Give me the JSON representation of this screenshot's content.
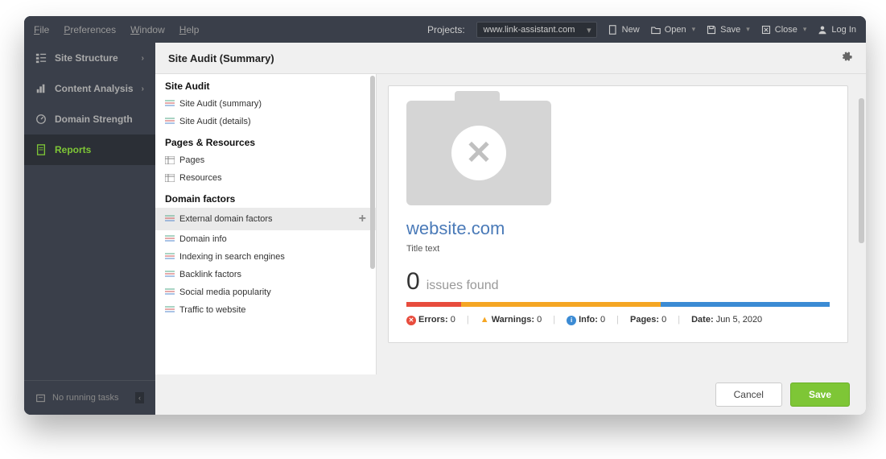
{
  "menubar": {
    "file": "File",
    "preferences": "Preferences",
    "window": "Window",
    "help": "Help",
    "projects_label": "Projects:",
    "project_value": "www.link-assistant.com",
    "new": "New",
    "open": "Open",
    "save": "Save",
    "close": "Close",
    "login": "Log In"
  },
  "sidebar": {
    "items": [
      {
        "label": "Site Structure"
      },
      {
        "label": "Content Analysis"
      },
      {
        "label": "Domain Strength"
      },
      {
        "label": "Reports"
      }
    ],
    "footer": "No running tasks"
  },
  "header": {
    "title": "Site Audit (Summary)"
  },
  "panel": {
    "g1_title": "Site Audit",
    "g1_items": [
      "Site Audit (summary)",
      "Site Audit (details)"
    ],
    "g2_title": "Pages & Resources",
    "g2_items": [
      "Pages",
      "Resources"
    ],
    "g3_title": "Domain factors",
    "g3_items": [
      "External domain factors",
      "Domain info",
      "Indexing in search engines",
      "Backlink factors",
      "Social media popularity",
      "Traffic to website"
    ]
  },
  "preview": {
    "site": "website.com",
    "subtitle": "Title text",
    "issues_count": "0",
    "issues_label": "issues found",
    "errors_label": "Errors:",
    "errors_val": "0",
    "warnings_label": "Warnings:",
    "warnings_val": "0",
    "info_label": "Info:",
    "info_val": "0",
    "pages_label": "Pages:",
    "pages_val": "0",
    "date_label": "Date:",
    "date_val": "Jun 5, 2020"
  },
  "footer": {
    "cancel": "Cancel",
    "save": "Save"
  }
}
